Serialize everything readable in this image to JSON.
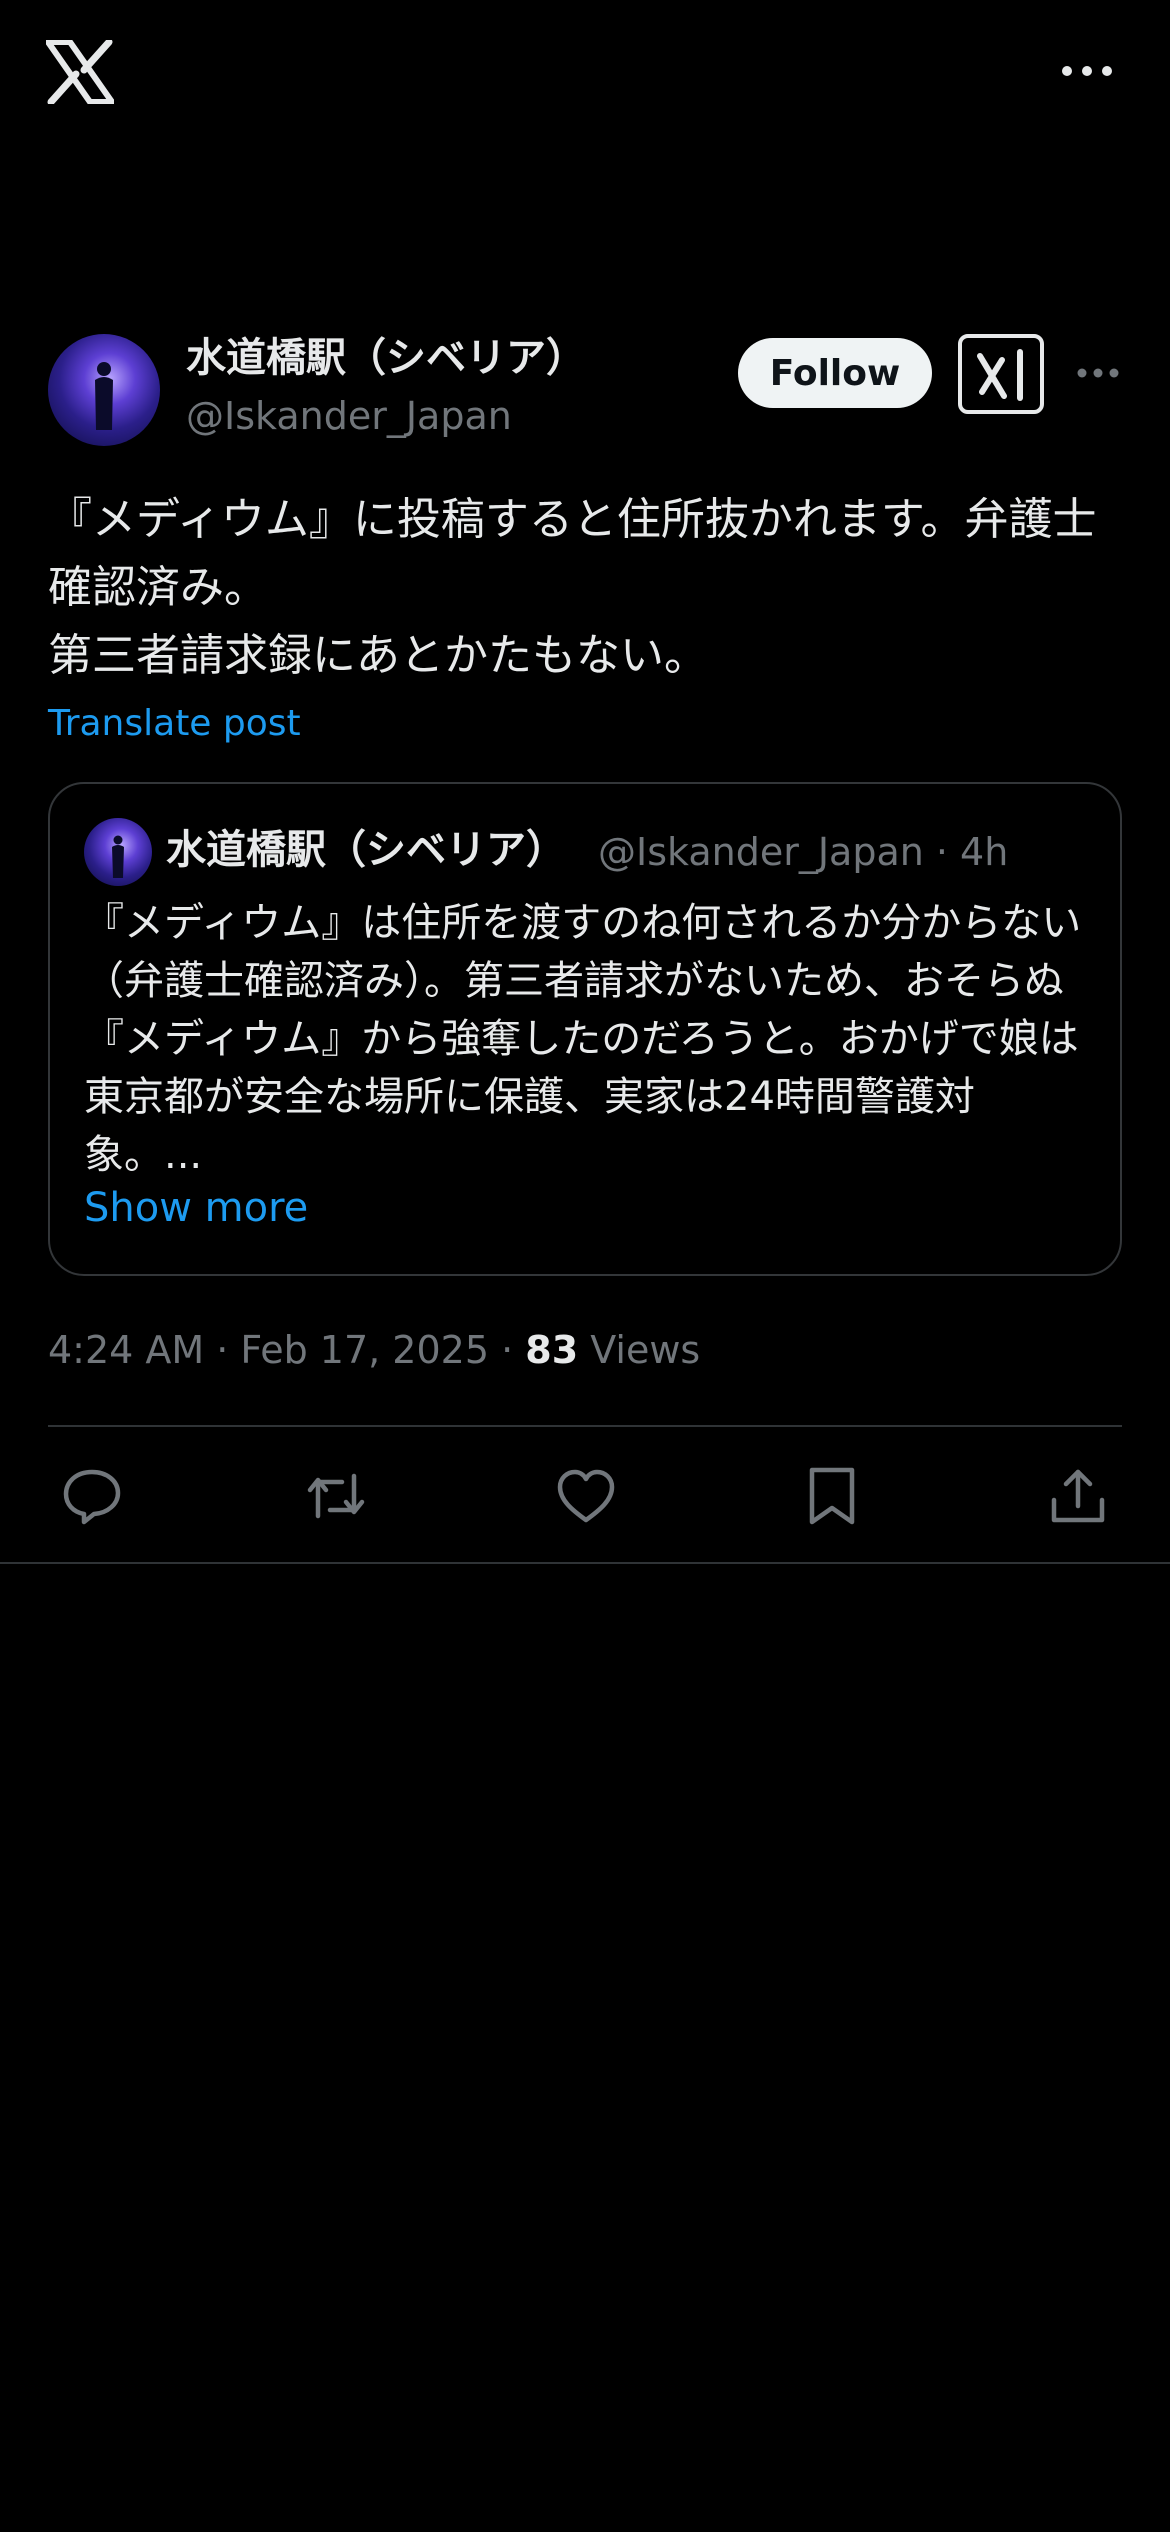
{
  "topbar": {
    "logo_icon": "x-logo-icon",
    "more_icon": "more-horizontal-icon"
  },
  "post": {
    "author": {
      "display_name": "水道橋駅（シベリア）",
      "handle": "@Iskander_Japan"
    },
    "follow_label": "Follow",
    "grok_icon": "grok-icon",
    "text": "『メディウム』に投稿すると住所抜かれます。弁護士確認済み。\n第三者請求録にあとかたもない。",
    "translate_label": "Translate post",
    "quoted": {
      "display_name": "水道橋駅（シベリア）",
      "handle_time": "@Iskander_Japan · 4h",
      "text": "『メディウム』は住所を渡すのね何されるか分からない（弁護士確認済み）。第三者請求がないため、おそらぬ『メディウム』から強奪したのだろうと。おかげで娘は東京都が安全な場所に保護、実家は24時間警護対象。...",
      "show_more_label": "Show more"
    },
    "timestamp": "4:24 AM · Feb 17, 2025 · ",
    "views_count": "83",
    "views_label": " Views"
  },
  "actions": {
    "reply_icon": "reply-icon",
    "repost_icon": "repost-icon",
    "like_icon": "like-icon",
    "bookmark_icon": "bookmark-icon",
    "share_icon": "share-icon"
  },
  "colors": {
    "background": "#000000",
    "text": "#e7e9ea",
    "secondary": "#71767b",
    "link": "#1d9bf0",
    "border": "#2f3336"
  }
}
